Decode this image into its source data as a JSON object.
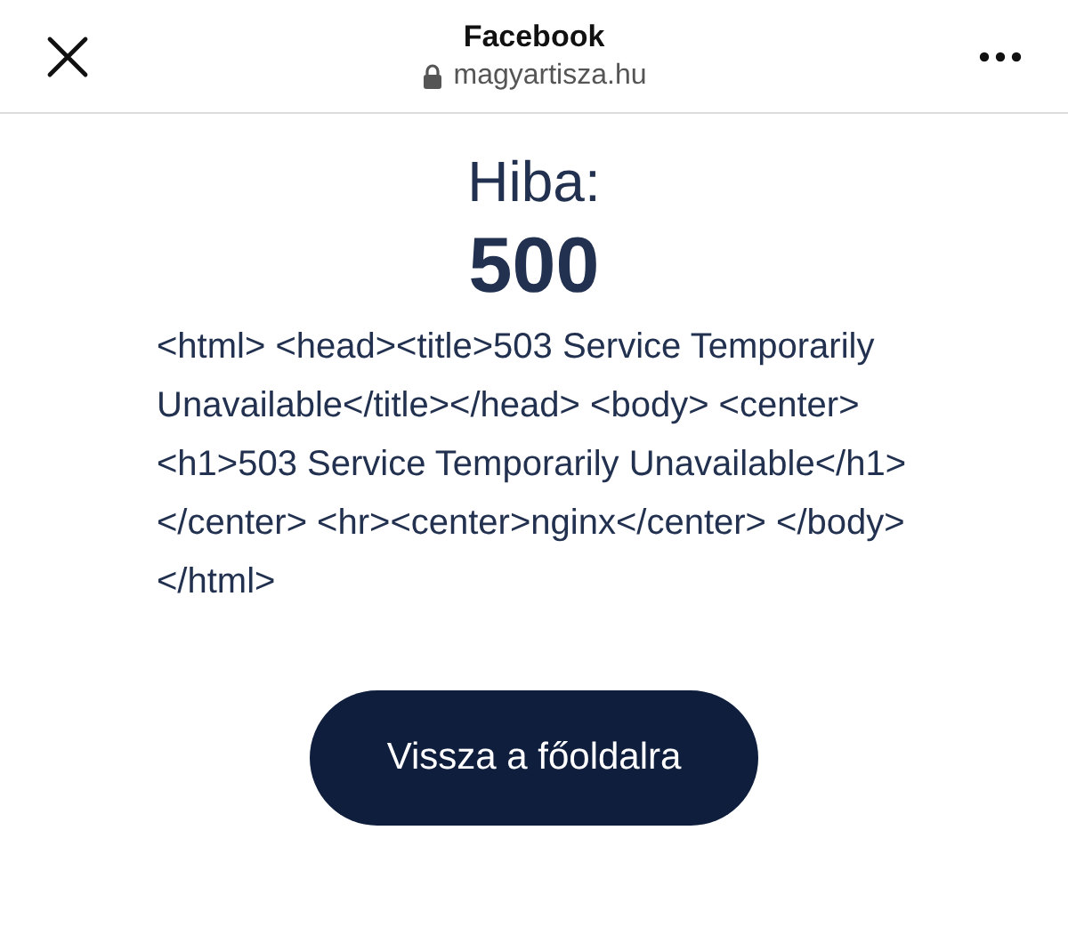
{
  "header": {
    "title": "Facebook",
    "url": "magyartisza.hu"
  },
  "error": {
    "heading": "Hiba:",
    "code": "500",
    "message": "<html> <head><title>503 Service Temporarily Unavailable</title></head> <body> <center><h1>503 Service Temporarily Unavailable</h1></center> <hr><center>nginx</center> </body> </html>"
  },
  "button": {
    "label": "Vissza a főoldalra"
  }
}
